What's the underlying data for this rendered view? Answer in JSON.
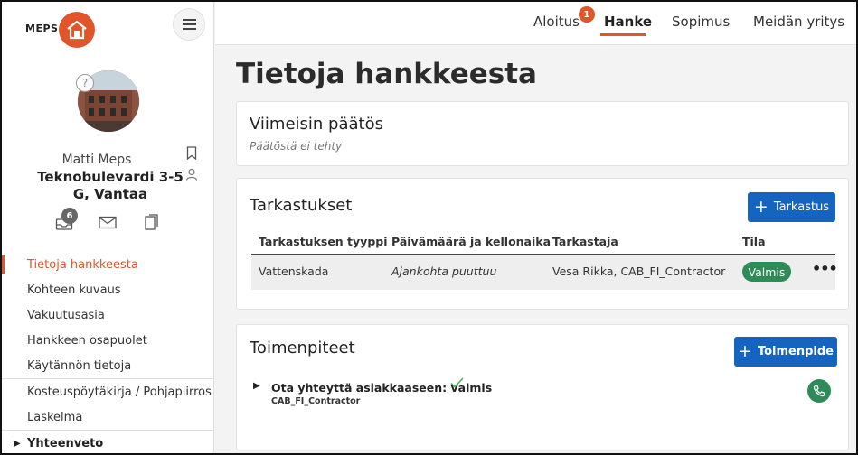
{
  "brand": {
    "logo_text": "MEPS"
  },
  "user": {
    "name": "Matti Meps",
    "address": "Teknobulevardi 3-5 G, Vantaa",
    "help": "?"
  },
  "badges": {
    "inbox_count": "6",
    "notifications": "1"
  },
  "sidebar": {
    "items": [
      {
        "label": "Tietoja hankkeesta",
        "active": true
      },
      {
        "label": "Kohteen kuvaus"
      },
      {
        "label": "Vakuutusasia"
      },
      {
        "label": "Hankkeen osapuolet"
      },
      {
        "label": "Käytännön tietoja"
      },
      {
        "label": "Kosteuspöytäkirja / Pohjapiirros"
      },
      {
        "label": "Laskelma"
      },
      {
        "label": "Yhteenveto"
      }
    ]
  },
  "topnav": {
    "tabs": [
      {
        "label": "Aloitus"
      },
      {
        "label": "Hanke",
        "active": true
      },
      {
        "label": "Sopimus"
      },
      {
        "label": "Meidän yritys"
      }
    ]
  },
  "page": {
    "title": "Tietoja hankkeesta"
  },
  "latest_decision": {
    "title": "Viimeisin päätös",
    "empty_text": "Päätöstä ei tehty"
  },
  "inspections": {
    "title": "Tarkastukset",
    "add_label": "Tarkastus",
    "columns": [
      "Tarkastuksen tyyppi",
      "Päivämäärä ja kellonaika",
      "Tarkastaja",
      "Tila"
    ],
    "rows": [
      {
        "type": "Vattenskada",
        "datetime": "Ajankohta puuttuu",
        "inspector": "Vesa Rikka, CAB_FI_Contractor",
        "status": "Valmis",
        "more": "•••"
      }
    ]
  },
  "actions": {
    "title": "Toimenpiteet",
    "add_label": "Toimenpide",
    "items": [
      {
        "title": "Ota yhteyttä asiakkaaseen: valmis",
        "subtitle": "CAB_FI_Contractor"
      }
    ]
  },
  "colors": {
    "accent": "#e0552a",
    "primary": "#1565c0",
    "success": "#2e8b57"
  }
}
